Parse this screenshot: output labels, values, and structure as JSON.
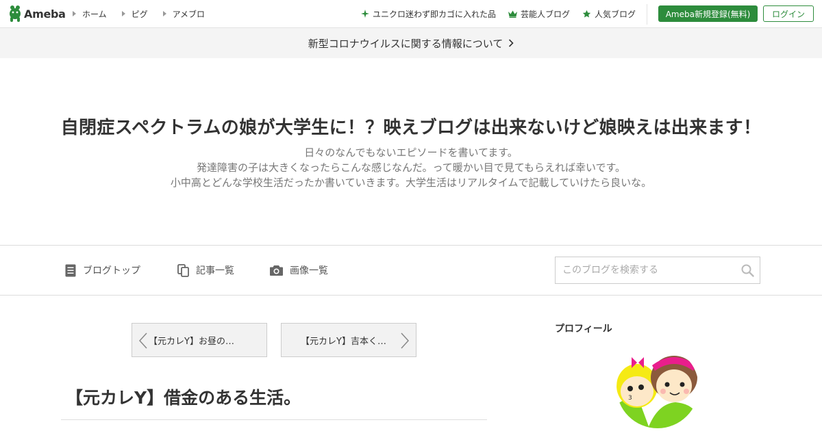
{
  "topbar": {
    "logo_text": "Ameba",
    "nav_left": [
      {
        "label": "ホーム"
      },
      {
        "label": "ピグ"
      },
      {
        "label": "アメブロ"
      }
    ],
    "nav_right": [
      {
        "label": "ユニクロ迷わず即カゴに入れた品",
        "icon": "sparkle-icon"
      },
      {
        "label": "芸能人ブログ",
        "icon": "crown-icon"
      },
      {
        "label": "人気ブログ",
        "icon": "star-icon"
      }
    ],
    "register_label": "Ameba新規登録(無料)",
    "login_label": "ログイン"
  },
  "notice": {
    "text": "新型コロナウイルスに関する情報について"
  },
  "header": {
    "title": "自閉症スペクトラムの娘が大学生に！？映えブログは出来ないけど娘映えは出来ます！",
    "description": [
      "日々のなんでもないエピソードを書いてます。",
      "発達障害の子は大きくなったらこんな感じなんだ。って暖かい目で見てもらえれば幸いです。",
      "小中高とどんな学校生活だったか書いていきます。大学生活はリアルタイムで記載していけたら良いな。"
    ]
  },
  "blog_nav": {
    "items": [
      {
        "label": "ブログトップ",
        "icon": "document-icon"
      },
      {
        "label": "記事一覧",
        "icon": "copy-icon"
      },
      {
        "label": "画像一覧",
        "icon": "camera-icon"
      }
    ],
    "search_placeholder": "このブログを検索する"
  },
  "pager": {
    "prev_label": "【元カレY】お昼の…",
    "next_label": "【元カレY】吉本く…"
  },
  "article": {
    "title": "【元カレY】借金のある生活。"
  },
  "sidebar": {
    "profile_heading": "プロフィール"
  },
  "colors": {
    "brand_green": "#2d8c3c",
    "notice_bg": "#f4f4f4"
  }
}
